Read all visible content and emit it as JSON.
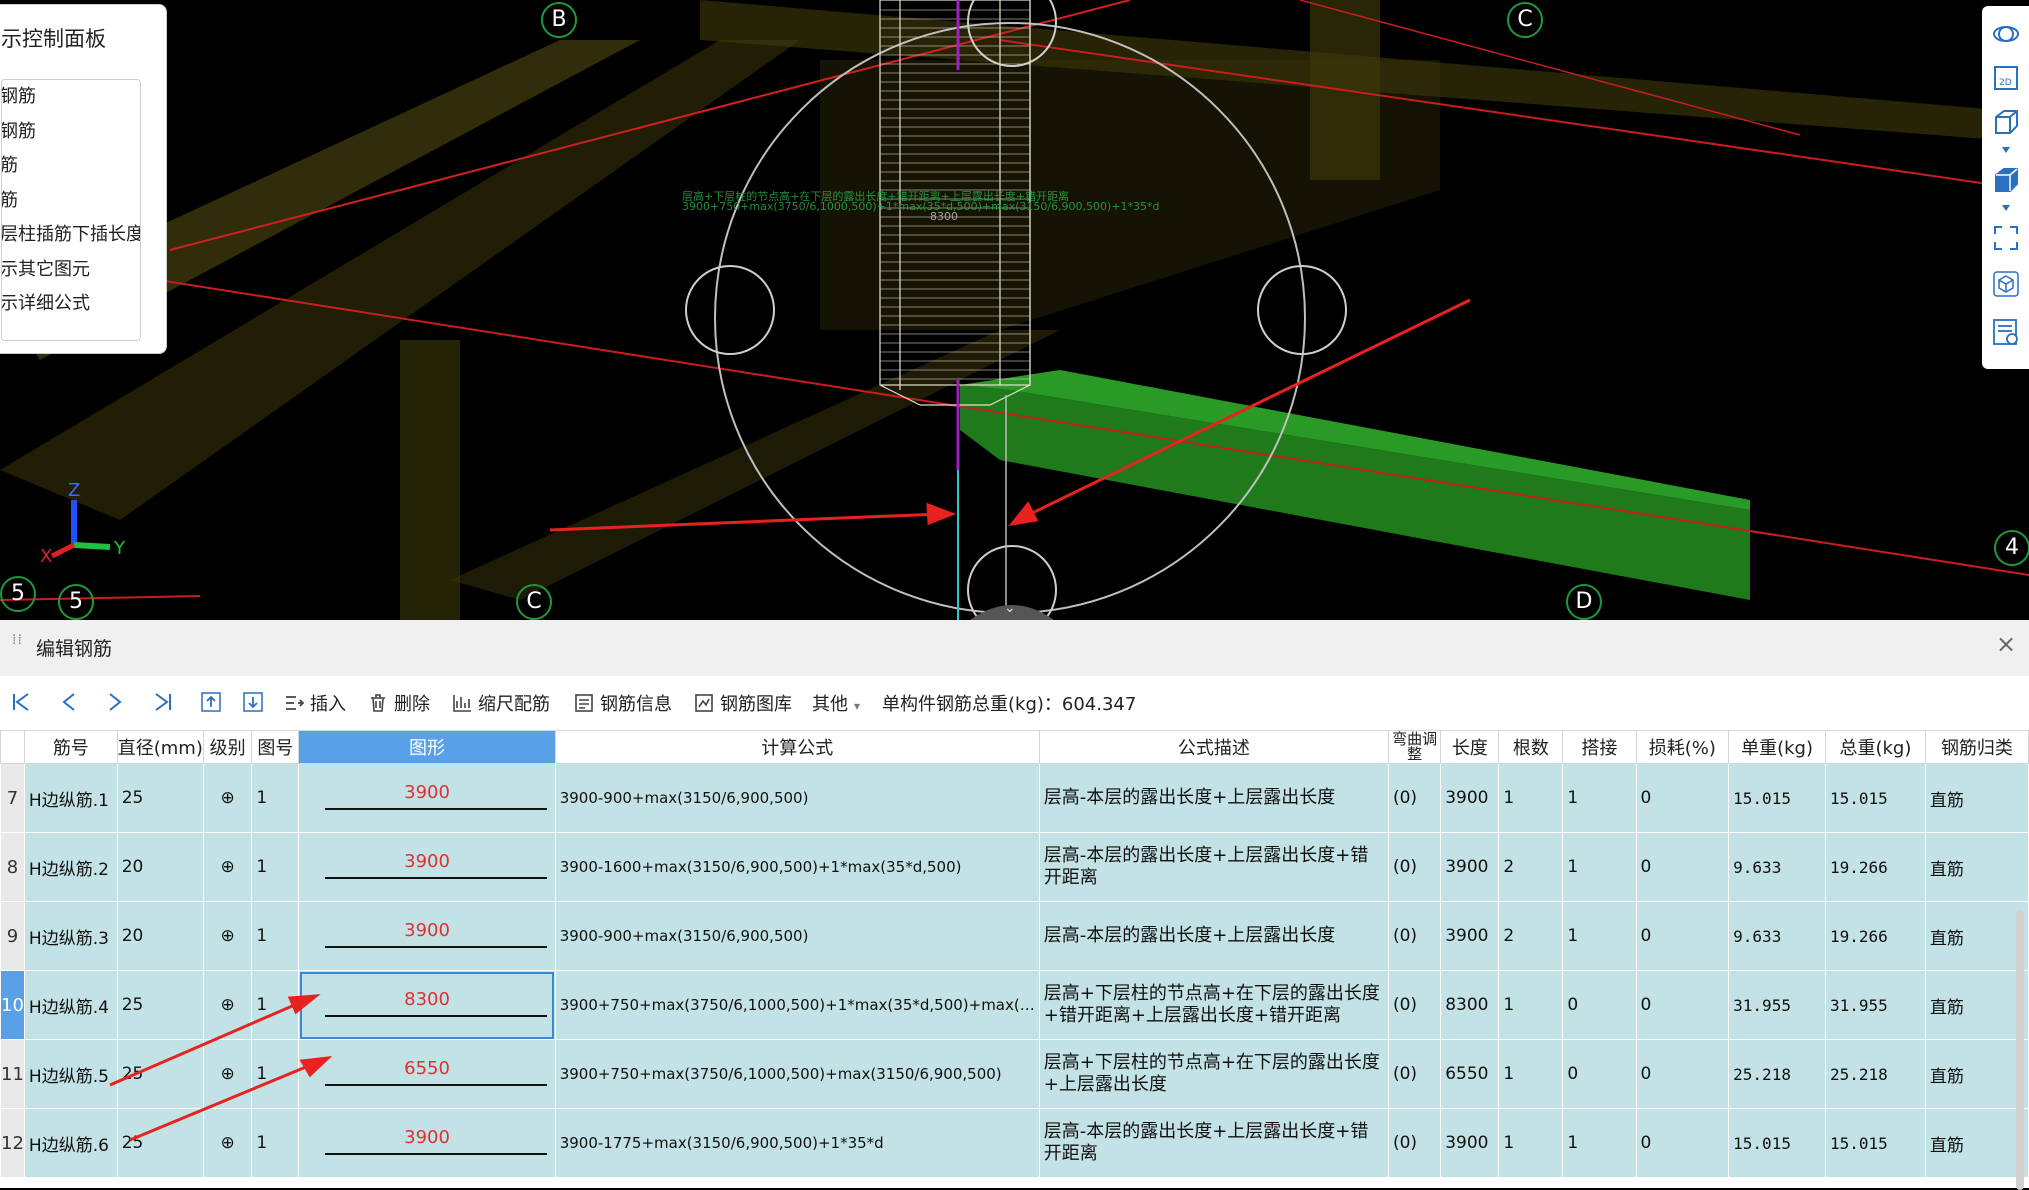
{
  "control_panel": {
    "title": "示控制面板",
    "items": [
      "钢筋",
      "钢筋",
      "筋",
      "筋",
      "层柱插筋下插长度",
      "示其它图元",
      "示详细公式"
    ]
  },
  "axis_labels": {
    "top_b": "B",
    "top_c": "C",
    "bottom_c": "C",
    "bottom_d": "D",
    "right_4": "4",
    "left_5a": "5",
    "left_5b": "5"
  },
  "coord_axes": {
    "z": "Z",
    "y": "Y",
    "x": "X"
  },
  "dim_text": {
    "line1": "层高+下层柱的节点高+在下层的露出长度+错开距离+上层露出长度+错开距离",
    "line2": "3900+750+max(3750/6,1000,500)+1*max(35*d,500)+max(3150/6,900,500)+1*35*d",
    "tag": "8300"
  },
  "right_tools": [
    "orbit-icon",
    "2d-icon",
    "3d-box-icon",
    "dropdown-icon",
    "3d-solid-icon",
    "dropdown-icon",
    "fullscreen-icon",
    "view-cube-icon",
    "list-settings-icon"
  ],
  "editor": {
    "title": "编辑钢筋",
    "close": "×",
    "toolbar": {
      "insert": "插入",
      "delete": "删除",
      "scale_bars": "缩尺配筋",
      "bar_info": "钢筋信息",
      "bar_library": "钢筋图库",
      "other": "其他",
      "total_weight": "单构件钢筋总重(kg)：604.347"
    },
    "columns": [
      "筋号",
      "直径(mm)",
      "级别",
      "图号",
      "图形",
      "计算公式",
      "公式描述",
      "弯曲调整",
      "长度",
      "根数",
      "搭接",
      "损耗(%)",
      "单重(kg)",
      "总重(kg)",
      "钢筋归类"
    ],
    "rows": [
      {
        "no": "7",
        "name": "H边纵筋.1",
        "dia": "25",
        "grade": "⊕",
        "fig": "1",
        "shape": "3900",
        "formula": "3900-900+max(3150/6,900,500)",
        "desc": "层高-本层的露出长度+上层露出长度",
        "bend": "(0)",
        "len": "3900",
        "count": "1",
        "lap": "1",
        "loss": "0",
        "unit": "15.015",
        "total": "15.015",
        "cat": "直筋"
      },
      {
        "no": "8",
        "name": "H边纵筋.2",
        "dia": "20",
        "grade": "⊕",
        "fig": "1",
        "shape": "3900",
        "formula": "3900-1600+max(3150/6,900,500)+1*max(35*d,500)",
        "desc": "层高-本层的露出长度+上层露出长度+错开距离",
        "bend": "(0)",
        "len": "3900",
        "count": "2",
        "lap": "1",
        "loss": "0",
        "unit": "9.633",
        "total": "19.266",
        "cat": "直筋"
      },
      {
        "no": "9",
        "name": "H边纵筋.3",
        "dia": "20",
        "grade": "⊕",
        "fig": "1",
        "shape": "3900",
        "formula": "3900-900+max(3150/6,900,500)",
        "desc": "层高-本层的露出长度+上层露出长度",
        "bend": "(0)",
        "len": "3900",
        "count": "2",
        "lap": "1",
        "loss": "0",
        "unit": "9.633",
        "total": "19.266",
        "cat": "直筋"
      },
      {
        "no": "10",
        "name": "H边纵筋.4",
        "dia": "25",
        "grade": "⊕",
        "fig": "1",
        "shape": "8300",
        "formula": "3900+750+max(3750/6,1000,500)+1*max(35*d,500)+max(…",
        "desc": "层高+下层柱的节点高+在下层的露出长度+错开距离+上层露出长度+错开距离",
        "bend": "(0)",
        "len": "8300",
        "count": "1",
        "lap": "0",
        "loss": "0",
        "unit": "31.955",
        "total": "31.955",
        "cat": "直筋"
      },
      {
        "no": "11",
        "name": "H边纵筋.5",
        "dia": "25",
        "grade": "⊕",
        "fig": "1",
        "shape": "6550",
        "formula": "3900+750+max(3750/6,1000,500)+max(3150/6,900,500)",
        "desc": "层高+下层柱的节点高+在下层的露出长度+上层露出长度",
        "bend": "(0)",
        "len": "6550",
        "count": "1",
        "lap": "0",
        "loss": "0",
        "unit": "25.218",
        "total": "25.218",
        "cat": "直筋"
      },
      {
        "no": "12",
        "name": "H边纵筋.6",
        "dia": "25",
        "grade": "⊕",
        "fig": "1",
        "shape": "3900",
        "formula": "3900-1775+max(3150/6,900,500)+1*35*d",
        "desc": "层高-本层的露出长度+上层露出长度+错开距离",
        "bend": "(0)",
        "len": "3900",
        "count": "1",
        "lap": "1",
        "loss": "0",
        "unit": "15.015",
        "total": "15.015",
        "cat": "直筋"
      }
    ]
  },
  "colors": {
    "row_bg": "#c3e2e6",
    "accent": "#5aa0e6",
    "shape_text": "#e03030",
    "annotation_arrow": "#e8231f"
  }
}
